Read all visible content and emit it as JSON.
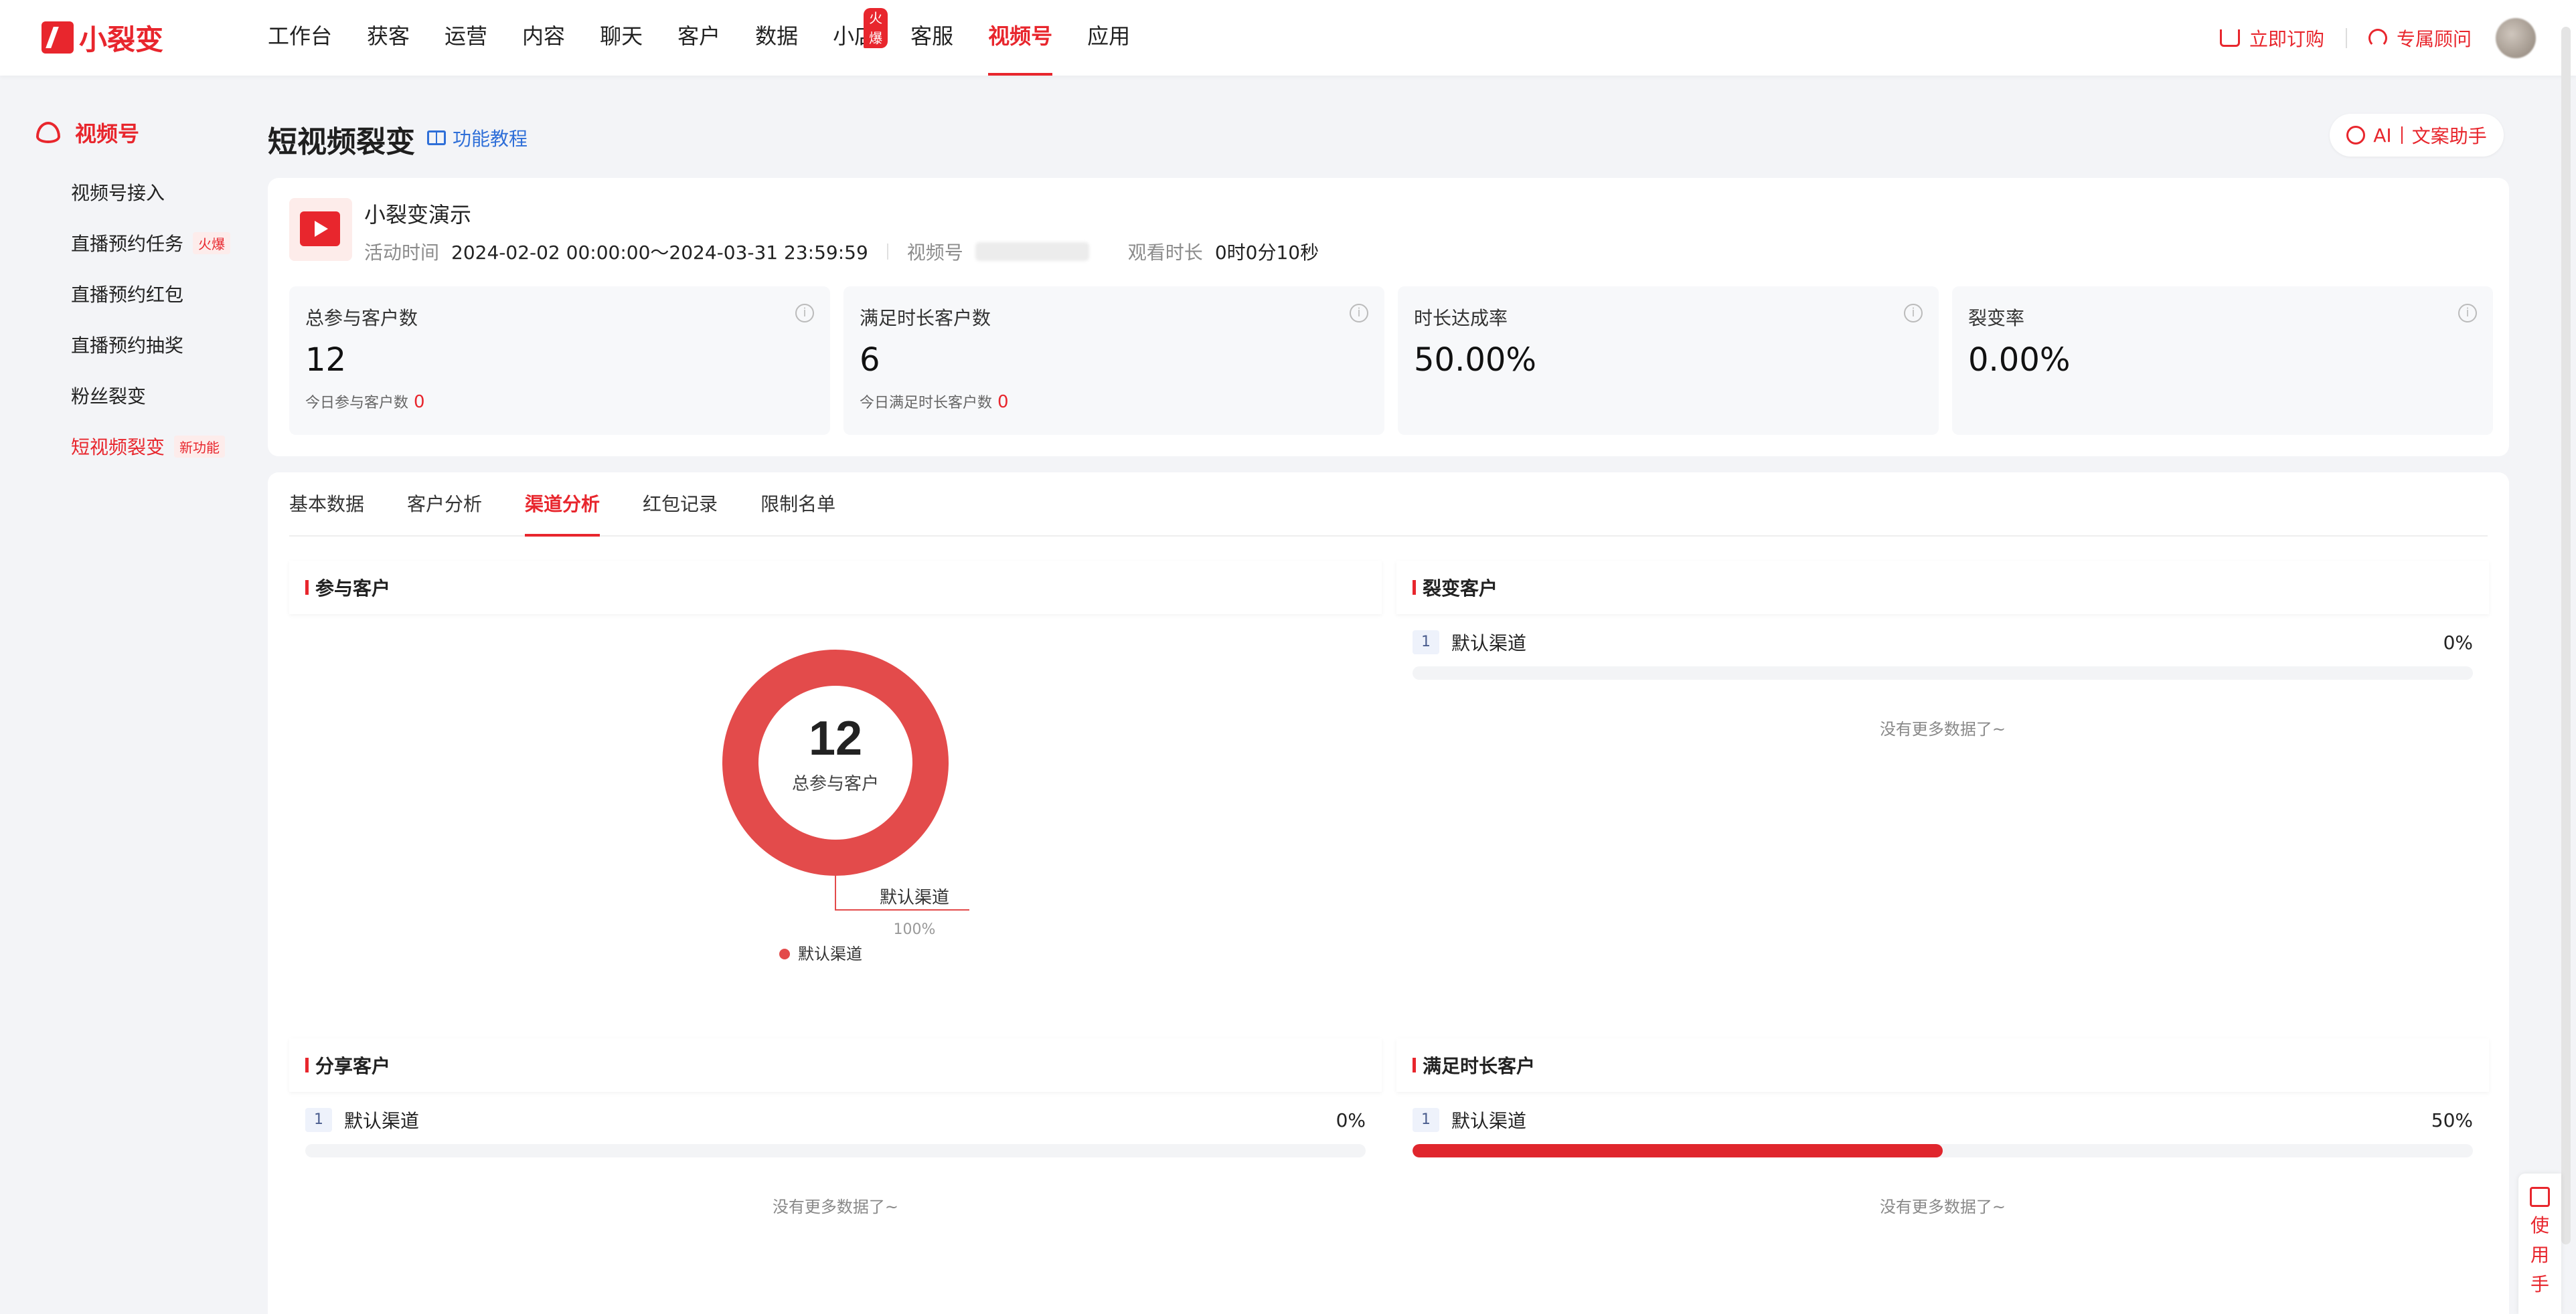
{
  "app": {
    "logo_text": "小裂变",
    "nav": [
      {
        "label": "工作台"
      },
      {
        "label": "获客"
      },
      {
        "label": "运营"
      },
      {
        "label": "内容"
      },
      {
        "label": "聊天"
      },
      {
        "label": "客户"
      },
      {
        "label": "数据"
      },
      {
        "label": "小店",
        "badge": "火爆"
      },
      {
        "label": "客服"
      },
      {
        "label": "视频号",
        "active": true
      },
      {
        "label": "应用"
      }
    ],
    "subscribe_label": "立即订购",
    "advisor_label": "专属顾问"
  },
  "sidebar": {
    "header": "视频号",
    "items": [
      {
        "label": "视频号接入"
      },
      {
        "label": "直播预约任务",
        "tag": "火爆"
      },
      {
        "label": "直播预约红包"
      },
      {
        "label": "直播预约抽奖"
      },
      {
        "label": "粉丝裂变"
      },
      {
        "label": "短视频裂变",
        "tag": "新功能",
        "active": true
      }
    ]
  },
  "page": {
    "title": "短视频裂变",
    "tutorial_label": "功能教程",
    "ai_label": "AI",
    "ai_assistant_label": "文案助手"
  },
  "activity": {
    "name": "小裂变演示",
    "time_label": "活动时间",
    "time_value": "2024-02-02 00:00:00～2024-03-31 23:59:59",
    "channel_label": "视频号",
    "watch_label": "观看时长",
    "watch_value": "0时0分10秒"
  },
  "stats": [
    {
      "label": "总参与客户数",
      "value": "12",
      "sub_label": "今日参与客户数",
      "sub_value": "0"
    },
    {
      "label": "满足时长客户数",
      "value": "6",
      "sub_label": "今日满足时长客户数",
      "sub_value": "0"
    },
    {
      "label": "时长达成率",
      "value": "50.00%"
    },
    {
      "label": "裂变率",
      "value": "0.00%"
    }
  ],
  "tabs": [
    {
      "label": "基本数据"
    },
    {
      "label": "客户分析"
    },
    {
      "label": "渠道分析",
      "active": true
    },
    {
      "label": "红包记录"
    },
    {
      "label": "限制名单"
    }
  ],
  "panels": {
    "participants": {
      "title": "参与客户",
      "center_value": "12",
      "center_label": "总参与客户",
      "callout_label": "默认渠道",
      "callout_pct": "100%",
      "legend": "默认渠道",
      "color": "#e34b4b"
    },
    "fission": {
      "title": "裂变客户",
      "rows": [
        {
          "rank": "1",
          "label": "默认渠道",
          "pct": "0%",
          "fraction": 0
        }
      ],
      "no_more": "没有更多数据了~"
    },
    "share": {
      "title": "分享客户",
      "rows": [
        {
          "rank": "1",
          "label": "默认渠道",
          "pct": "0%",
          "fraction": 0
        }
      ],
      "no_more": "没有更多数据了~"
    },
    "duration": {
      "title": "满足时长客户",
      "rows": [
        {
          "rank": "1",
          "label": "默认渠道",
          "pct": "50%",
          "fraction": 0.5
        }
      ],
      "no_more": "没有更多数据了~"
    }
  },
  "manual_label": [
    "使",
    "用",
    "手"
  ],
  "colors": {
    "accent": "#e8262d",
    "link": "#2f6fd8"
  }
}
